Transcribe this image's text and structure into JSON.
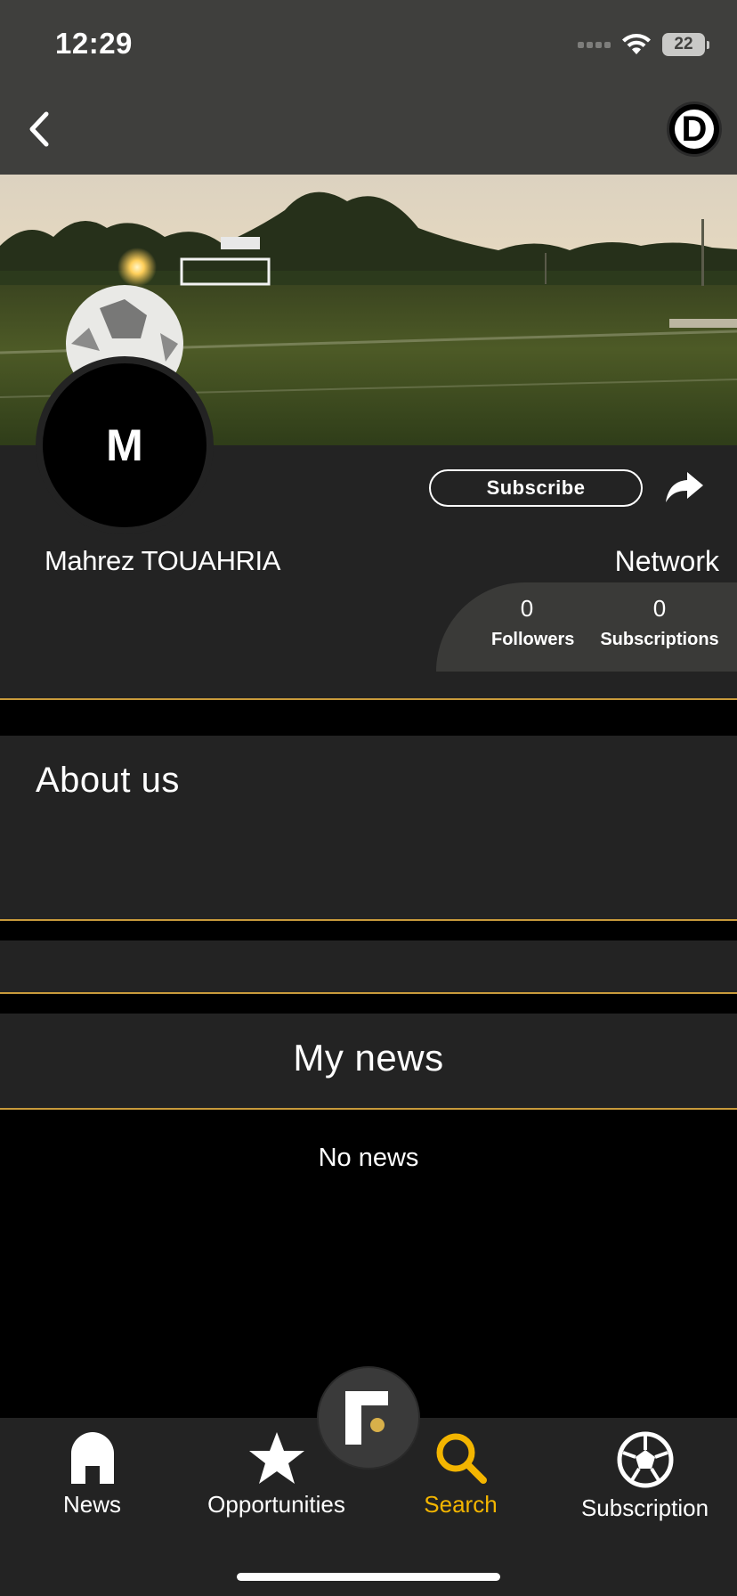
{
  "status_bar": {
    "time": "12:29",
    "battery": "22"
  },
  "header": {
    "back_icon": "chevron-left-icon",
    "logo_letter": "D"
  },
  "profile": {
    "avatar_letter": "M",
    "name": "Mahrez TOUAHRIA",
    "subscribe_label": "Subscribe",
    "share_icon": "share-icon",
    "network_label": "Network",
    "followers_count": "0",
    "followers_label": "Followers",
    "subscriptions_count": "0",
    "subscriptions_label": "Subscriptions"
  },
  "about": {
    "title": "About us"
  },
  "news": {
    "title": "My news",
    "empty_text": "No news"
  },
  "tabs": [
    {
      "label": "News",
      "icon": "home-icon",
      "active": false
    },
    {
      "label": "Opportunities",
      "icon": "star-icon",
      "active": false
    },
    {
      "label": "Search",
      "icon": "search-icon",
      "active": true
    },
    {
      "label": "Subscription",
      "icon": "soccer-ball-icon",
      "active": false
    }
  ],
  "colors": {
    "accent": "#f3b500",
    "divider": "#c89a3b",
    "surface": "#232323",
    "header": "#3f3f3d",
    "background": "#000000"
  }
}
